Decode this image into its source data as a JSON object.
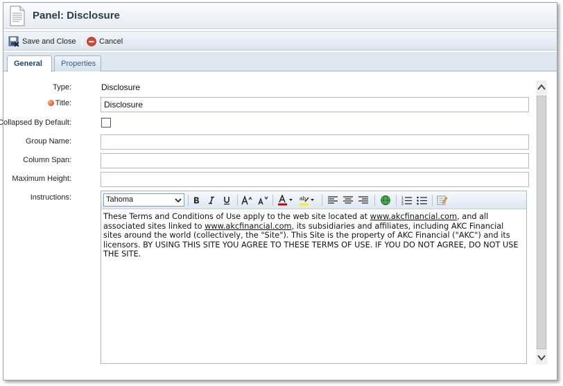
{
  "window": {
    "title": "Panel: Disclosure"
  },
  "toolbar": {
    "save_label": "Save and Close",
    "cancel_label": "Cancel"
  },
  "tabs": [
    {
      "label": "General",
      "active": true
    },
    {
      "label": "Properties",
      "active": false
    }
  ],
  "form": {
    "type_label": "Type:",
    "type_value": "Disclosure",
    "title_label": "Title:",
    "title_value": "Disclosure",
    "collapsed_label": "Collapsed By Default:",
    "collapsed_checked": false,
    "group_name_label": "Group Name:",
    "group_name_value": "",
    "column_span_label": "Column Span:",
    "column_span_value": "",
    "max_height_label": "Maximum Height:",
    "max_height_value": "",
    "instructions_label": "Instructions:"
  },
  "editor": {
    "font": "Tahoma",
    "text_1": "These Terms and Conditions of Use apply to the web site located at ",
    "link_1": "www.akcfinancial.com",
    "text_2": ", and all associated sites linked to ",
    "link_2": "www.akcfinancial.com",
    "text_3": ", its subsidiaries and affiliates, including AKC Financial sites around the world (collectively, the \"Site\"). This Site is the property of AKC Financial (\"AKC\") and its licensors. BY USING THIS SITE YOU AGREE TO THESE TERMS OF USE. IF YOU DO NOT AGREE, DO NOT USE THE SITE."
  },
  "colors": {
    "required_indicator": "#e2561c",
    "font_color_bar": "#cc0000",
    "highlight_bar": "#ffee00",
    "tab_active_text": "#15428b"
  }
}
